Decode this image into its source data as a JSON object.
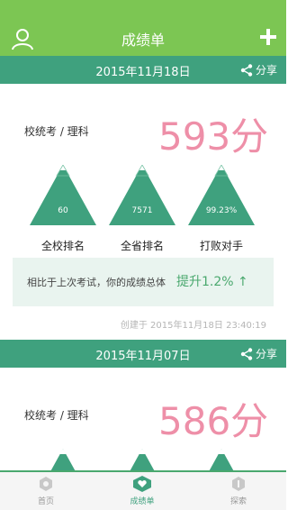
{
  "header": {
    "title": "成绩单"
  },
  "records": [
    {
      "date": "2015年11月18日",
      "share_label": "分享",
      "exam_type": "校统考 / 理科",
      "score": "593分",
      "ranks": [
        {
          "value": "60",
          "label": "全校排名"
        },
        {
          "value": "7571",
          "label": "全省排名"
        },
        {
          "value": "99.23%",
          "label": "打败对手"
        }
      ],
      "compare_text": "相比于上次考试，你的成绩总体",
      "compare_result": "提升1.2%",
      "compare_arrow": "↑",
      "created": "创建于 2015年11月18日 23:40:19"
    },
    {
      "date": "2015年11月07日",
      "share_label": "分享",
      "exam_type": "校统考 / 理科",
      "score": "586分"
    }
  ],
  "tabs": [
    {
      "label": "首页",
      "icon": "hexagon-icon"
    },
    {
      "label": "成绩单",
      "icon": "heart-icon"
    },
    {
      "label": "探索",
      "icon": "explore-icon"
    }
  ],
  "colors": {
    "topbar": "#7cc653",
    "card_header": "#3fa17e",
    "score": "#ee8fa8",
    "triangle": "#3fa17e"
  }
}
